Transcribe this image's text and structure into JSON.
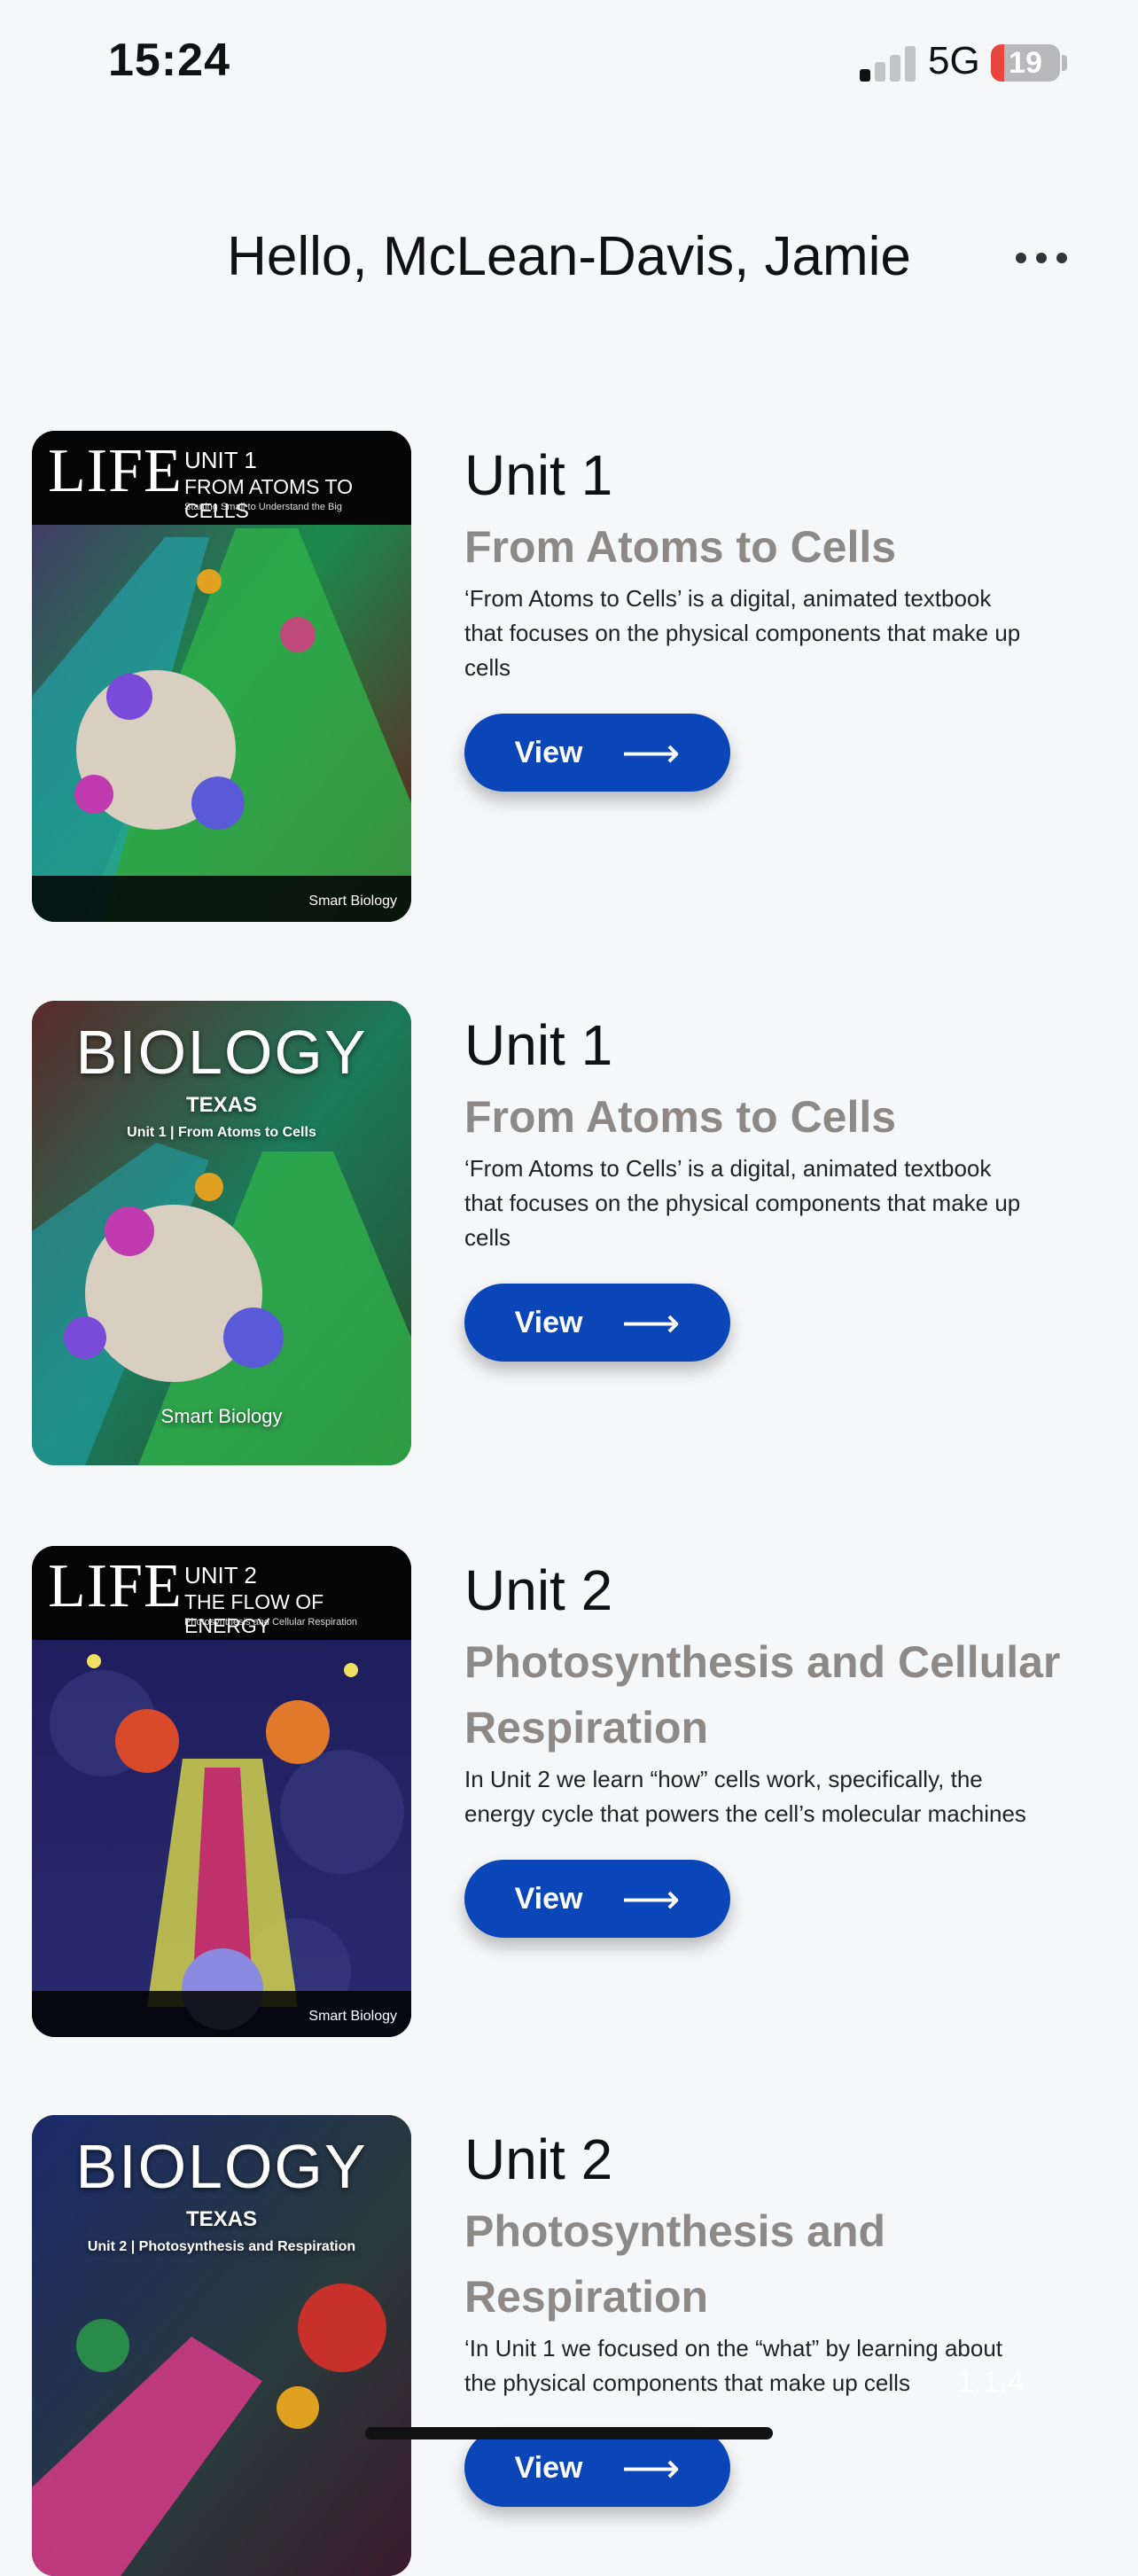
{
  "status_bar": {
    "time": "15:24",
    "network": "5G",
    "battery": "19",
    "battery_level": 0.19,
    "signal_bars_active": 1
  },
  "header": {
    "greeting": "Hello, McLean-Davis, Jamie",
    "more_icon": "ellipsis-icon"
  },
  "units": [
    {
      "cover": {
        "style": "life",
        "brand": "LIFE",
        "unit": "UNIT 1",
        "subtitle": "FROM ATOMS TO CELLS",
        "tagline": "Starting Small to Understand the Big",
        "publisher": "Smart Biology"
      },
      "number": "Unit 1",
      "title": "From Atoms to Cells",
      "description": "‘From Atoms to Cells’ is a digital, animated textbook that focuses on the physical components that make up cells",
      "button": "View",
      "button_icon": "arrow-right-icon"
    },
    {
      "cover": {
        "style": "biology",
        "brand": "BIOLOGY",
        "state": "TEXAS",
        "line": "Unit 1 | From Atoms to Cells",
        "publisher": "Smart Biology"
      },
      "number": "Unit 1",
      "title": "From Atoms to Cells",
      "description": "‘From Atoms to Cells’ is a digital, animated textbook that focuses on the physical components that make up cells",
      "button": "View",
      "button_icon": "arrow-right-icon"
    },
    {
      "cover": {
        "style": "life",
        "brand": "LIFE",
        "unit": "UNIT 2",
        "subtitle": "THE FLOW OF ENERGY",
        "tagline": "Photosynthesis and Cellular Respiration",
        "publisher": "Smart Biology"
      },
      "number": "Unit 2",
      "title": "Photosynthesis and Cellular Respiration",
      "description": "In Unit 2 we learn “how” cells work, specifically, the energy cycle that powers the cell’s molecular machines",
      "button": "View",
      "button_icon": "arrow-right-icon"
    },
    {
      "cover": {
        "style": "biology",
        "brand": "BIOLOGY",
        "state": "TEXAS",
        "line": "Unit 2 | Photosynthesis and Respiration",
        "publisher": ""
      },
      "number": "Unit 2",
      "title": "Photosynthesis and Respiration",
      "description": "‘In Unit 1 we focused on the “what” by learning about the physical components that make up cells",
      "button": "View",
      "button_icon": "arrow-right-icon"
    }
  ],
  "version": "1.1.4",
  "colors": {
    "accent": "#0a46b8",
    "title_gray": "#8d8987",
    "background": "#f6f7f9"
  }
}
